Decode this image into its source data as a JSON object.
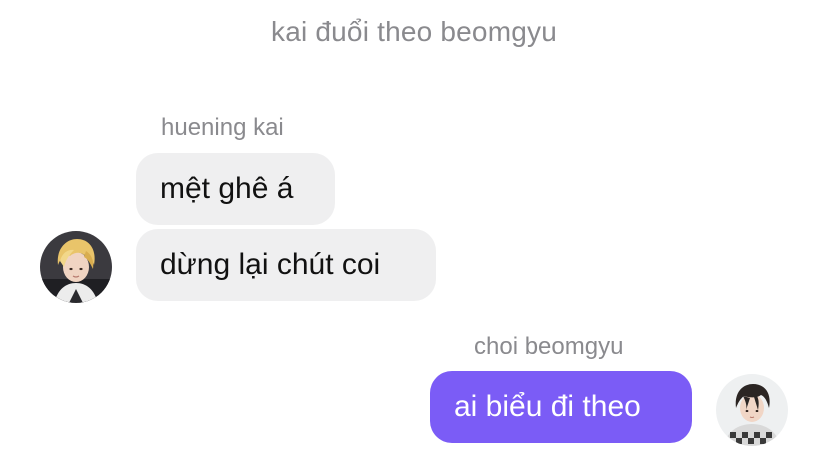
{
  "chat": {
    "title": "kai đuổi theo beomgyu"
  },
  "messages": {
    "incoming": {
      "sender": "huening kai",
      "items": [
        "mệt ghê á",
        "dừng lại chút coi"
      ]
    },
    "outgoing": {
      "sender": "choi beomgyu",
      "items": [
        "ai biểu đi theo"
      ]
    }
  },
  "colors": {
    "incoming_bubble": "#efeff0",
    "outgoing_bubble": "#7b5cf6",
    "meta_text": "#8a8a8e"
  },
  "icons": {
    "left_avatar": "avatar-blonde-person-photo",
    "right_avatar": "avatar-dark-hair-person-photo"
  }
}
